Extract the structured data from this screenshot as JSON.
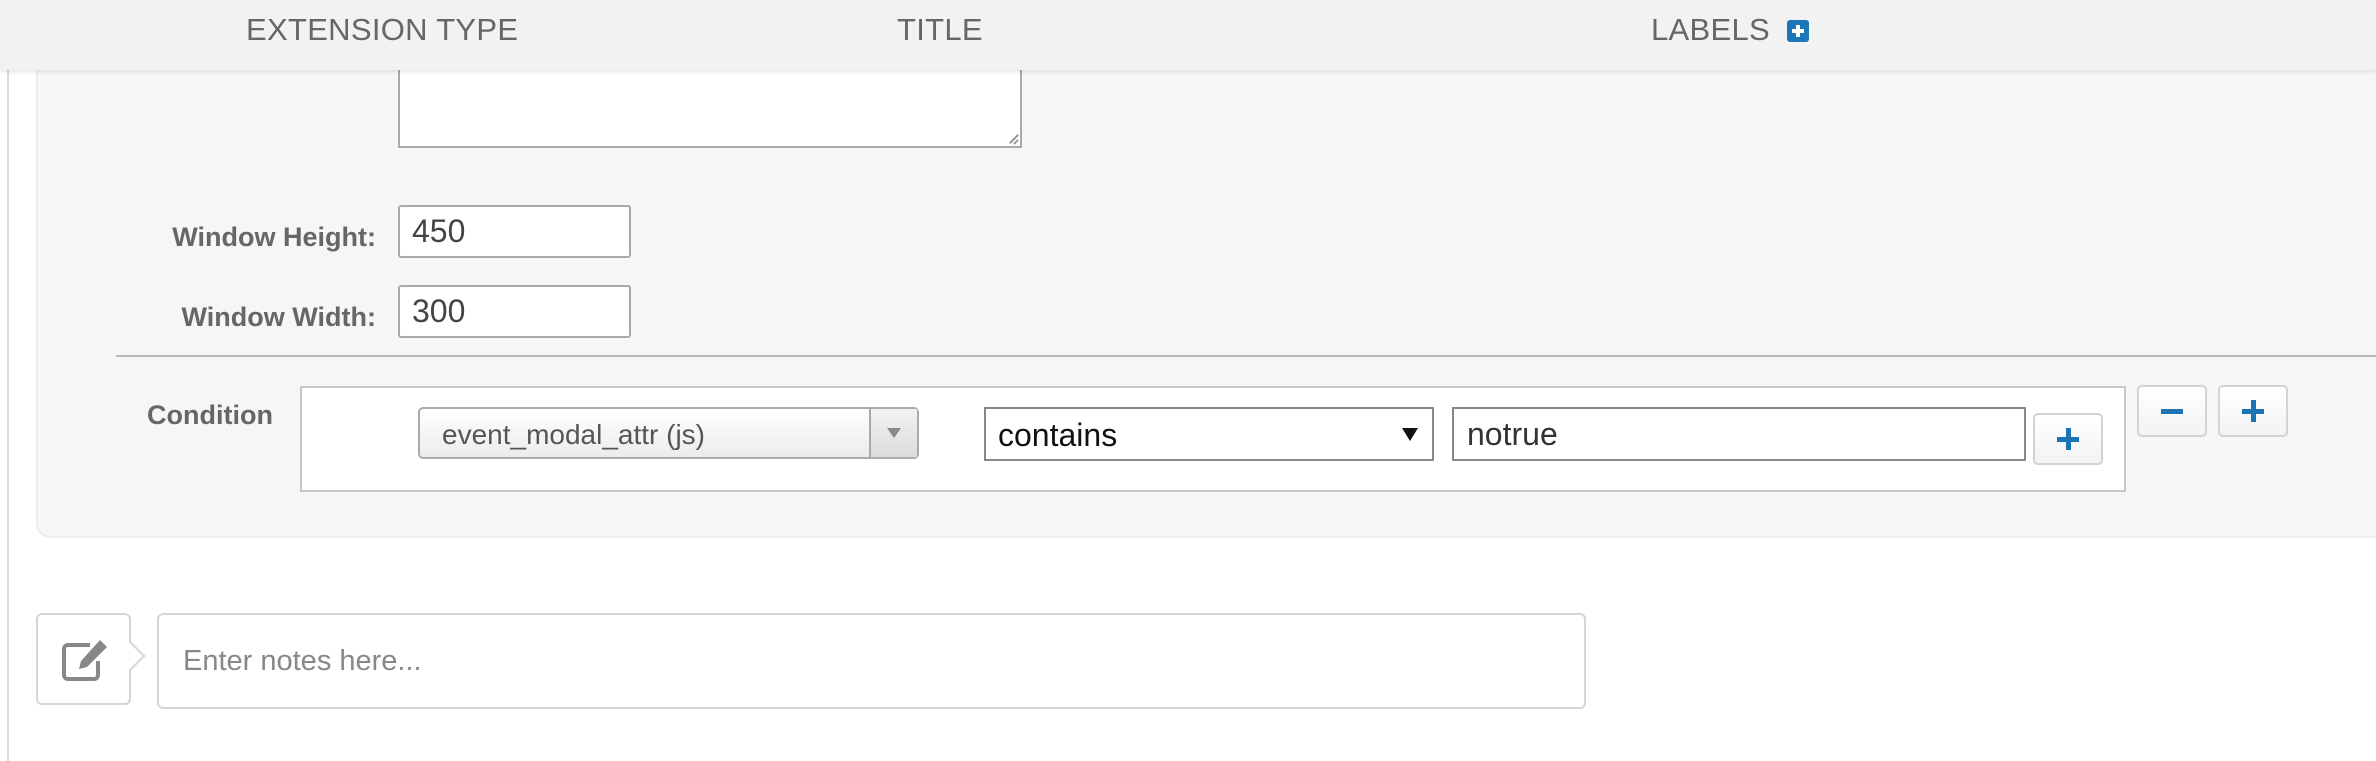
{
  "header": {
    "col_extension_type": "EXTENSION TYPE",
    "col_title": "TITLE",
    "col_labels": "LABELS"
  },
  "form": {
    "window_height_label": "Window Height:",
    "window_height_value": "450",
    "window_width_label": "Window Width:",
    "window_width_value": "300"
  },
  "condition": {
    "label": "Condition",
    "variable": "event_modal_attr (js)",
    "operator": "contains",
    "value": "notrue"
  },
  "notes": {
    "placeholder": "Enter notes here..."
  },
  "icons": {
    "add_label": "plus-square-icon",
    "add_condition": "plus-icon",
    "remove_group": "minus-icon",
    "add_group": "plus-icon",
    "notes": "edit-icon"
  },
  "colors": {
    "accent": "#1a74b4",
    "header_bg": "#f2f2f2",
    "panel_bg": "#f6f6f6"
  }
}
